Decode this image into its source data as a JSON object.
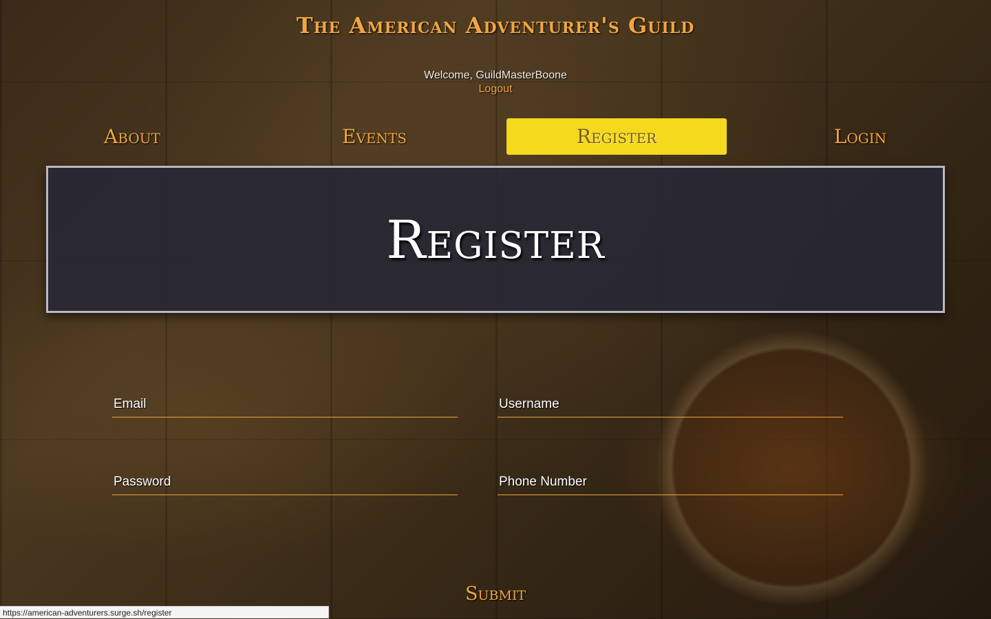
{
  "header": {
    "site_title": "The American Adventurer's Guild",
    "welcome_text": "Welcome, GuildMasterBoone",
    "logout_label": "Logout"
  },
  "nav": {
    "items": [
      {
        "label": "About",
        "active": false
      },
      {
        "label": "Events",
        "active": false
      },
      {
        "label": "Register",
        "active": true
      },
      {
        "label": "Login",
        "active": false
      }
    ]
  },
  "banner": {
    "title": "Register"
  },
  "form": {
    "email": {
      "placeholder": "Email",
      "value": ""
    },
    "username": {
      "placeholder": "Username",
      "value": ""
    },
    "password": {
      "placeholder": "Password",
      "value": ""
    },
    "phone": {
      "placeholder": "Phone Number",
      "value": ""
    },
    "submit_label": "Submit"
  },
  "status_bar": {
    "url": "https://american-adventurers.surge.sh/register"
  },
  "colors": {
    "accent": "#f0a640",
    "active_nav_bg": "#f5d91c",
    "banner_bg": "#28283a",
    "banner_border": "#b9b9be"
  }
}
